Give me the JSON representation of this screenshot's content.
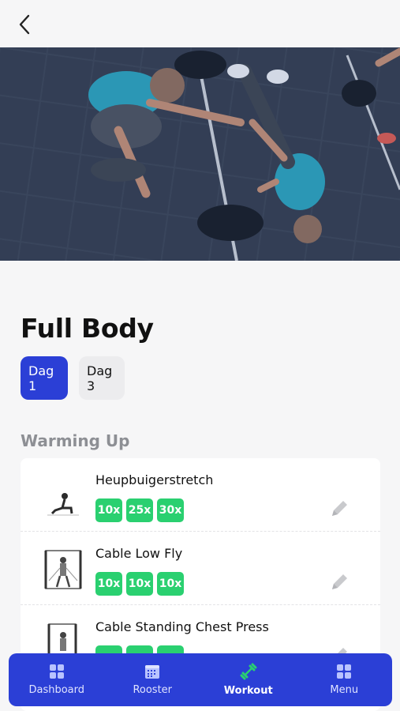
{
  "header": {
    "back_icon": "chevron-left-icon"
  },
  "hero": {
    "image": "crossfit-barbell-photo"
  },
  "workout": {
    "title": "Full Body",
    "days": [
      {
        "label": "Dag 1",
        "active": true
      },
      {
        "label": "Dag 3",
        "active": false
      }
    ]
  },
  "section": {
    "title": "Warming Up"
  },
  "exercises": [
    {
      "name": "Heupbuigerstretch",
      "reps": [
        "10x",
        "25x",
        "30x"
      ],
      "thumb": "lunge-stretch-thumbnail"
    },
    {
      "name": "Cable Low Fly",
      "reps": [
        "10x",
        "10x",
        "10x"
      ],
      "thumb": "cable-machine-thumbnail"
    },
    {
      "name": "Cable Standing Chest Press",
      "reps": [
        "",
        "",
        ""
      ],
      "thumb": "cable-machine-thumbnail"
    }
  ],
  "nav": {
    "items": [
      {
        "label": "Dashboard",
        "icon": "grid-icon",
        "active": false
      },
      {
        "label": "Rooster",
        "icon": "calendar-icon",
        "active": false
      },
      {
        "label": "Workout",
        "icon": "dumbbell-icon",
        "active": true
      },
      {
        "label": "Menu",
        "icon": "grid-icon",
        "active": false
      }
    ]
  },
  "colors": {
    "accent": "#2b3fd6",
    "badge": "#2ad070",
    "section_title": "#8d8f94",
    "active_icon": "#2ad070"
  }
}
